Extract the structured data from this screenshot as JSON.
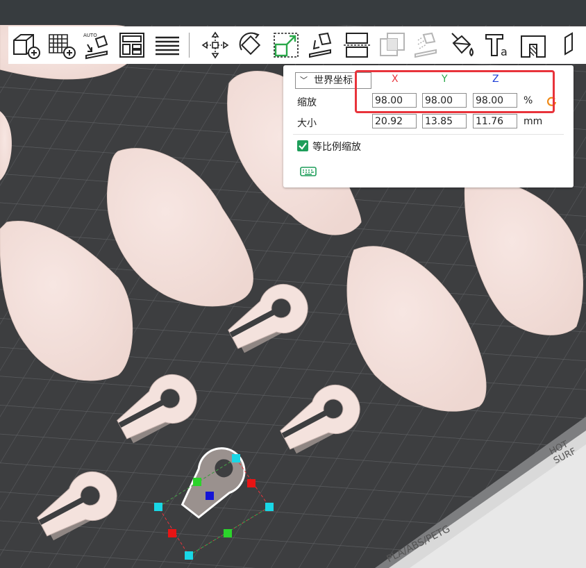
{
  "toolbar": {
    "items": [
      {
        "name": "add-part-icon"
      },
      {
        "name": "add-plate-icon"
      },
      {
        "name": "auto-orient-icon",
        "text": "AUTO"
      },
      {
        "name": "arrange-icon"
      },
      {
        "name": "layers-icon"
      },
      {
        "name": "move-icon"
      },
      {
        "name": "rotate-icon"
      },
      {
        "name": "scale-icon"
      },
      {
        "name": "lay-on-face-icon"
      },
      {
        "name": "cut-icon"
      },
      {
        "name": "boolean-icon"
      },
      {
        "name": "support-paint-icon"
      },
      {
        "name": "color-paint-icon"
      },
      {
        "name": "text-icon",
        "text": "a"
      },
      {
        "name": "measure-icon"
      },
      {
        "name": "assembly-icon"
      }
    ]
  },
  "scale_panel": {
    "coord_system": "世界坐标",
    "axes": {
      "x": "X",
      "y": "Y",
      "z": "Z"
    },
    "axis_colors": {
      "x": "#e8333b",
      "y": "#2aa84a",
      "z": "#1e3fd6"
    },
    "scale_label": "缩放",
    "scale_values": {
      "x": "98.00",
      "y": "98.00",
      "z": "98.00"
    },
    "scale_unit": "%",
    "size_label": "大小",
    "size_values": {
      "x": "20.92",
      "y": "13.85",
      "z": "11.76"
    },
    "size_unit": "mm",
    "uniform_scale_label": "等比例缩放",
    "uniform_scale_checked": true
  },
  "plate": {
    "hot_label": "HOT",
    "surface_label": "SURF",
    "material_label": "PLA/ABS/PETG"
  }
}
